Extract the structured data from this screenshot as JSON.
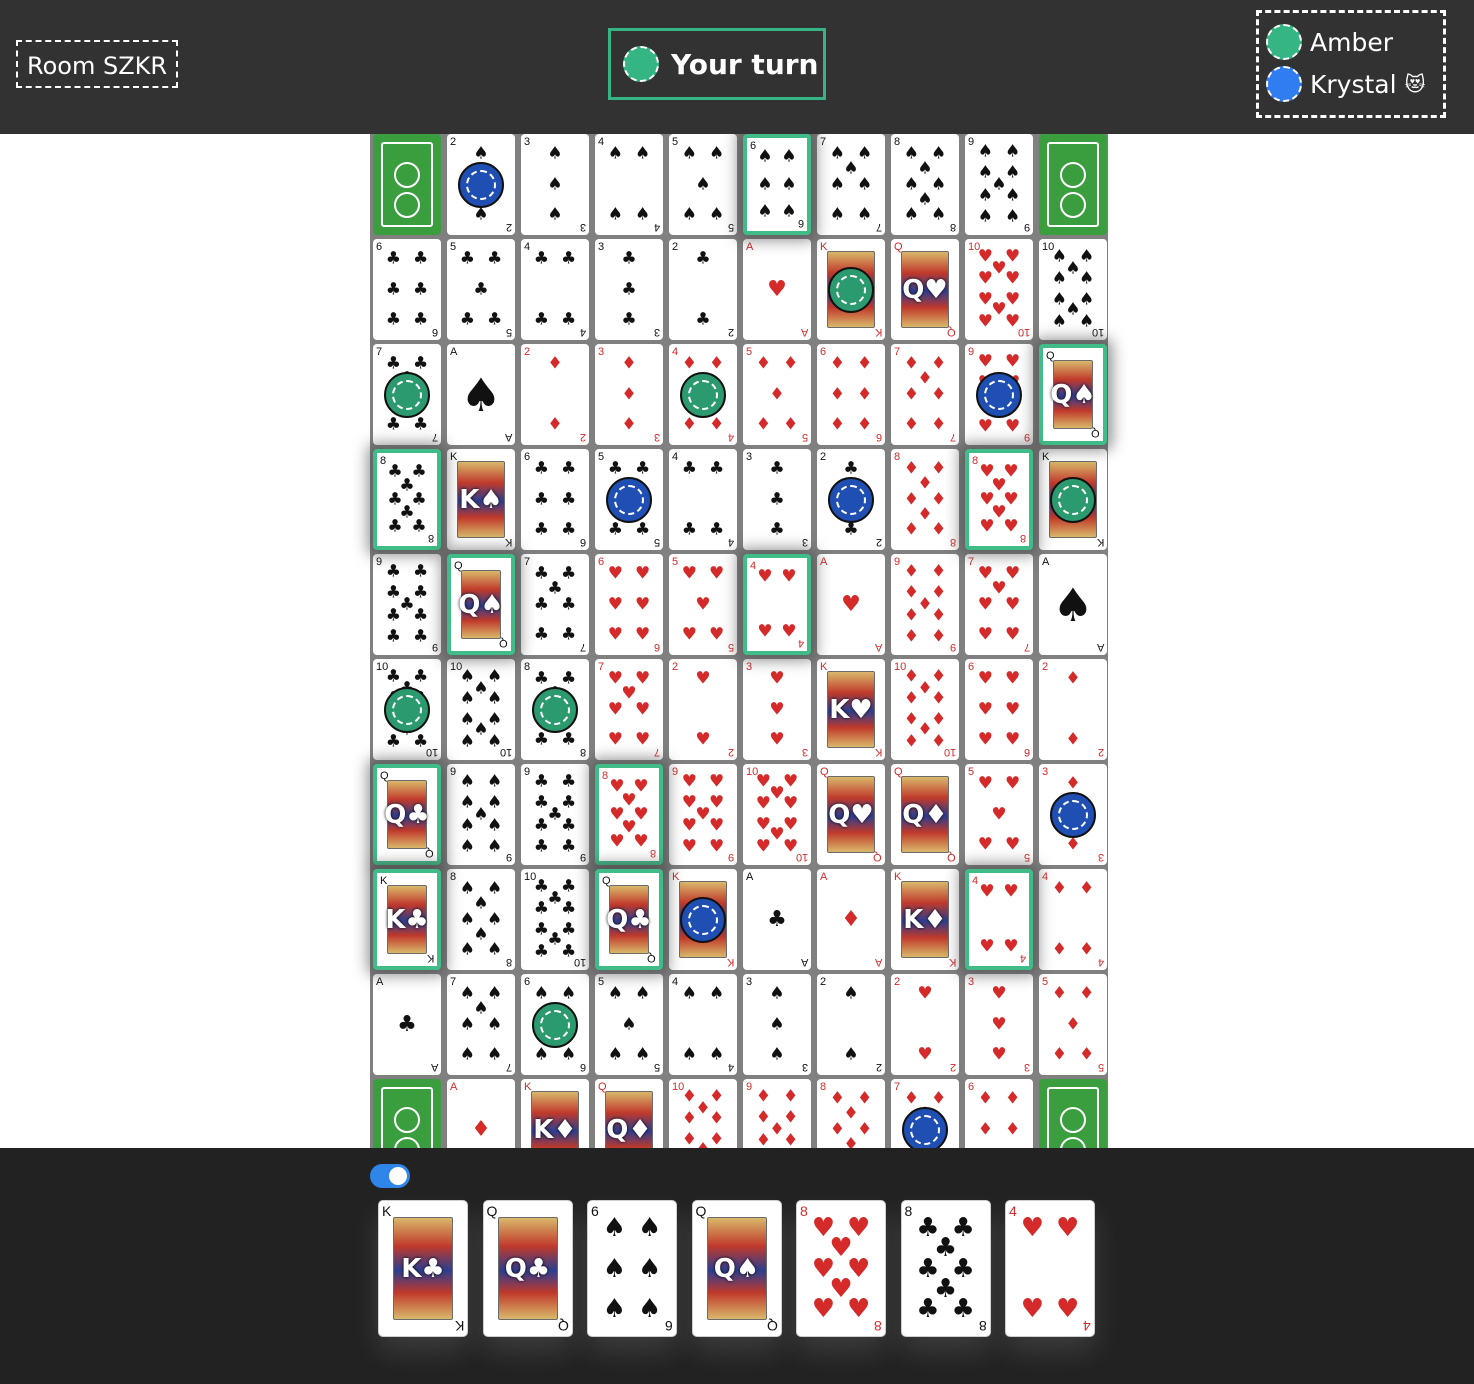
{
  "header": {
    "room": "Room SZKR",
    "turn": "Your turn",
    "players": [
      {
        "name": "Amber",
        "color": "#35b584",
        "emoji": ""
      },
      {
        "name": "Krystal",
        "color": "#2f7df0",
        "emoji": "😻"
      }
    ]
  },
  "colors": {
    "green_chip": "#2b9a6e",
    "blue_chip": "#1f4fb3",
    "highlight": "#3fbc87",
    "red_suit": "#d42a2a"
  },
  "board": {
    "rows": [
      [
        "X",
        "2♠",
        "3♠",
        "4♠",
        "5♠",
        "6♠",
        "7♠",
        "8♠",
        "9♠",
        "X"
      ],
      [
        "6♣",
        "5♣",
        "4♣",
        "3♣",
        "2♣",
        "A♥",
        "K♥",
        "Q♥",
        "10♥",
        "10♠"
      ],
      [
        "7♣",
        "A♠",
        "2♦",
        "3♦",
        "4♦",
        "5♦",
        "6♦",
        "7♦",
        "9♥",
        "Q♠"
      ],
      [
        "8♣",
        "K♠",
        "6♣",
        "5♣",
        "4♣",
        "3♣",
        "2♣",
        "8♦",
        "8♥",
        "K♠"
      ],
      [
        "9♣",
        "Q♠",
        "7♣",
        "6♥",
        "5♥",
        "4♥",
        "A♥",
        "9♦",
        "7♥",
        "A♠"
      ],
      [
        "10♣",
        "10♠",
        "8♣",
        "7♥",
        "2♥",
        "3♥",
        "K♥",
        "10♦",
        "6♥",
        "2♦"
      ],
      [
        "Q♣",
        "9♠",
        "9♣",
        "8♥",
        "9♥",
        "10♥",
        "Q♥",
        "Q♦",
        "5♥",
        "3♦"
      ],
      [
        "K♣",
        "8♠",
        "10♣",
        "Q♣",
        "K♦",
        "A♣",
        "A♦",
        "K♦",
        "4♥",
        "4♦"
      ],
      [
        "A♣",
        "7♠",
        "6♠",
        "5♠",
        "4♠",
        "3♠",
        "2♠",
        "2♥",
        "3♥",
        "5♦"
      ],
      [
        "X",
        "A♦",
        "K♦",
        "Q♦",
        "10♦",
        "9♦",
        "8♦",
        "7♦",
        "6♦",
        "X"
      ]
    ],
    "chips": [
      {
        "row": 0,
        "col": 1,
        "team": "blue"
      },
      {
        "row": 1,
        "col": 6,
        "team": "green"
      },
      {
        "row": 2,
        "col": 0,
        "team": "green"
      },
      {
        "row": 2,
        "col": 4,
        "team": "green"
      },
      {
        "row": 2,
        "col": 8,
        "team": "blue"
      },
      {
        "row": 3,
        "col": 3,
        "team": "blue"
      },
      {
        "row": 3,
        "col": 6,
        "team": "blue"
      },
      {
        "row": 3,
        "col": 9,
        "team": "green"
      },
      {
        "row": 5,
        "col": 0,
        "team": "green"
      },
      {
        "row": 5,
        "col": 2,
        "team": "green"
      },
      {
        "row": 6,
        "col": 9,
        "team": "blue"
      },
      {
        "row": 7,
        "col": 4,
        "team": "blue"
      },
      {
        "row": 8,
        "col": 2,
        "team": "green"
      },
      {
        "row": 9,
        "col": 7,
        "team": "blue"
      }
    ],
    "highlighted": [
      [
        0,
        5
      ],
      [
        2,
        9
      ],
      [
        3,
        0
      ],
      [
        3,
        8
      ],
      [
        4,
        1
      ],
      [
        4,
        5
      ],
      [
        6,
        0
      ],
      [
        6,
        3
      ],
      [
        7,
        0
      ],
      [
        7,
        3
      ],
      [
        7,
        8
      ]
    ]
  },
  "hand": {
    "toggle_on": true,
    "cards": [
      "K♣",
      "Q♣",
      "6♠",
      "Q♠",
      "8♥",
      "8♣",
      "4♥"
    ]
  }
}
